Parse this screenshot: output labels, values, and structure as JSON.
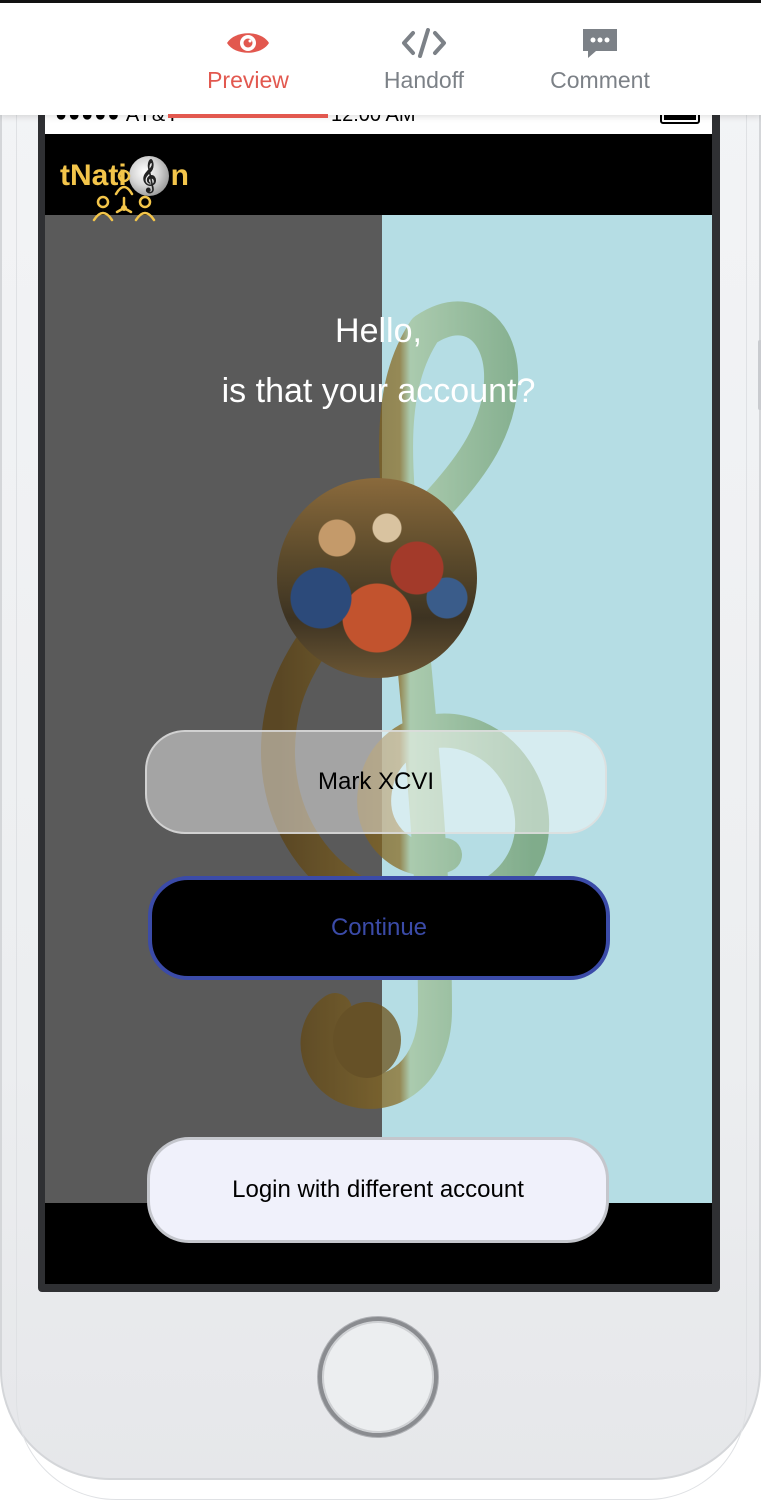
{
  "tabs": {
    "preview_label": "Preview",
    "handoff_label": "Handoff",
    "comment_label": "Comment",
    "active": "Preview"
  },
  "status_bar": {
    "carrier": "●●●●● AT&T",
    "time": "12:00 AM"
  },
  "app": {
    "logo_text_pre": "tNati",
    "logo_text_post": "n",
    "greeting_line1": "Hello,",
    "greeting_line2": "is that your account?",
    "account_name": "Mark XCVI",
    "continue_label": "Continue",
    "different_account_label": "Login with different account"
  },
  "colors": {
    "accent": "#e2584f",
    "logo": "#f3c54a",
    "continue_border": "#3b4ba8",
    "bg_left": "#5a5a5a",
    "bg_right": "#b5dde4"
  },
  "icons": {
    "preview": "eye-icon",
    "handoff": "code-icon",
    "comment": "comment-bubble-icon"
  }
}
